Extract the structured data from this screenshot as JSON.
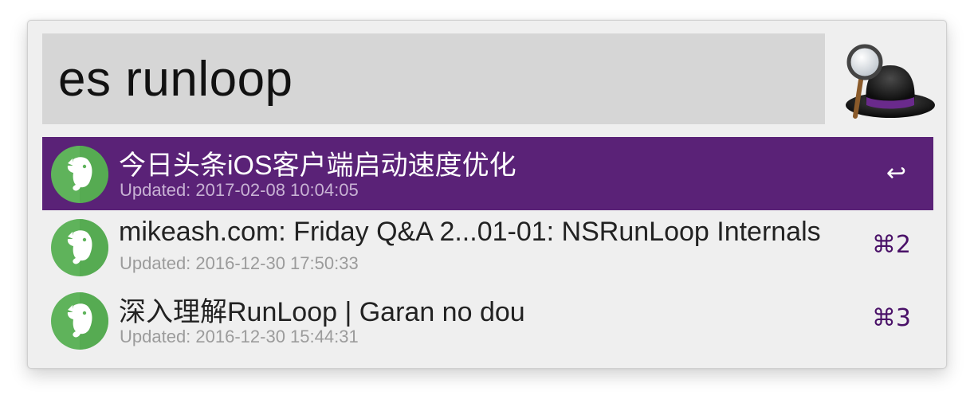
{
  "search": {
    "query": "es runloop"
  },
  "logo": {
    "icon": "alfred-hat-magnifier-icon"
  },
  "results": [
    {
      "title": "今日头条iOS客户端启动速度优化",
      "subtitle": "Updated: 2017-02-08 10:04:05",
      "shortcut": "↩",
      "selected": true,
      "icon": "evernote-elephant-icon"
    },
    {
      "title": "mikeash.com: Friday Q&A 2...01-01: NSRunLoop Internals",
      "subtitle": "Updated: 2016-12-30 17:50:33",
      "shortcut": "⌘2",
      "selected": false,
      "icon": "evernote-elephant-icon"
    },
    {
      "title": "深入理解RunLoop | Garan no dou",
      "subtitle": "Updated: 2016-12-30 15:44:31",
      "shortcut": "⌘3",
      "selected": false,
      "icon": "evernote-elephant-icon"
    }
  ],
  "colors": {
    "selection": "#5a2277",
    "shortcut": "#4a1168",
    "evernote_green": "#5fb35b"
  }
}
